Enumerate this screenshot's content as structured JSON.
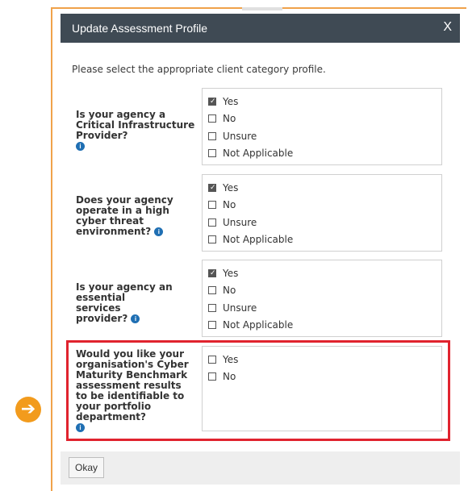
{
  "dialog": {
    "title": "Update Assessment Profile",
    "close_label": "X",
    "intro": "Please select the appropriate client category profile."
  },
  "questions": [
    {
      "text": "Is your agency a Critical Infrastructure Provider?",
      "options": [
        {
          "label": "Yes",
          "checked": true
        },
        {
          "label": "No",
          "checked": false
        },
        {
          "label": "Unsure",
          "checked": false
        },
        {
          "label": "Not Applicable",
          "checked": false
        }
      ]
    },
    {
      "text": "Does your agency operate in a high cyber threat environment?",
      "options": [
        {
          "label": "Yes",
          "checked": true
        },
        {
          "label": "No",
          "checked": false
        },
        {
          "label": "Unsure",
          "checked": false
        },
        {
          "label": "Not Applicable",
          "checked": false
        }
      ]
    },
    {
      "text": "Is your agency an essential services provider?",
      "options": [
        {
          "label": "Yes",
          "checked": true
        },
        {
          "label": "No",
          "checked": false
        },
        {
          "label": "Unsure",
          "checked": false
        },
        {
          "label": "Not Applicable",
          "checked": false
        }
      ]
    },
    {
      "text": "Would you like your organisation's Cyber Maturity Benchmark assessment results to be identifiable to your portfolio department?",
      "options": [
        {
          "label": "Yes",
          "checked": false
        },
        {
          "label": "No",
          "checked": false
        }
      ]
    }
  ],
  "footer": {
    "okay_label": "Okay"
  },
  "info_icon_glyph": "i",
  "arrow_glyph": "➔",
  "colors": {
    "titlebar": "#3f4a54",
    "highlight": "#e0232e",
    "arrow_badge": "#f29b1d",
    "frame": "#f0a24a",
    "info": "#1f6fb3"
  }
}
